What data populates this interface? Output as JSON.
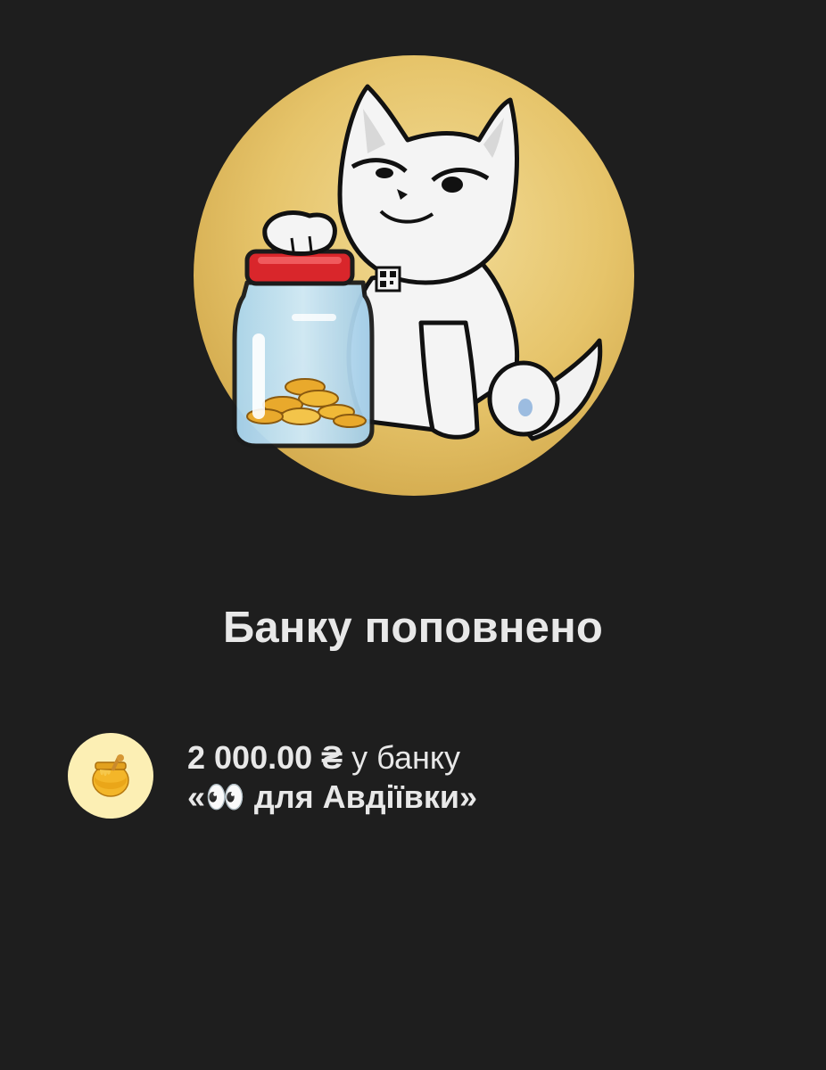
{
  "status": {
    "title": "Банку поповнено"
  },
  "transaction": {
    "amount": "2 000.00 ₴",
    "suffix": " у банку",
    "jar_name": "«👀 для Авдіївки»",
    "icon": "honey-pot-icon"
  },
  "hero": {
    "illustration": "cat-with-coin-jar",
    "circle_color": "#e8c469"
  }
}
